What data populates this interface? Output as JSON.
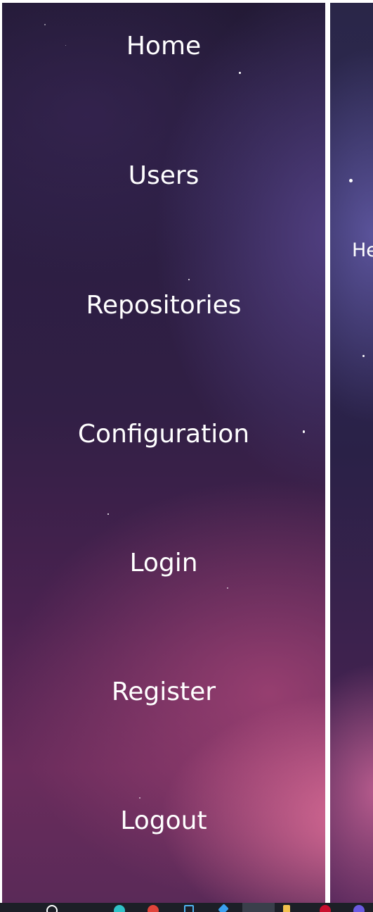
{
  "sidebar": {
    "items": [
      {
        "label": "Home"
      },
      {
        "label": "Users"
      },
      {
        "label": "Repositories"
      },
      {
        "label": "Configuration"
      },
      {
        "label": "Login"
      },
      {
        "label": "Register"
      },
      {
        "label": "Logout"
      }
    ]
  },
  "main": {
    "partial_text": "He"
  },
  "colors": {
    "nav_text": "#ffffff",
    "divider": "#ffffff",
    "taskbar": "#1c1f27"
  },
  "taskbar": {
    "icons": [
      "search-icon",
      "teal-app-icon",
      "chrome-icon",
      "file-explorer-icon",
      "store-icon",
      "vscode-icon",
      "folder-icon",
      "opera-icon",
      "purple-app-icon"
    ]
  }
}
